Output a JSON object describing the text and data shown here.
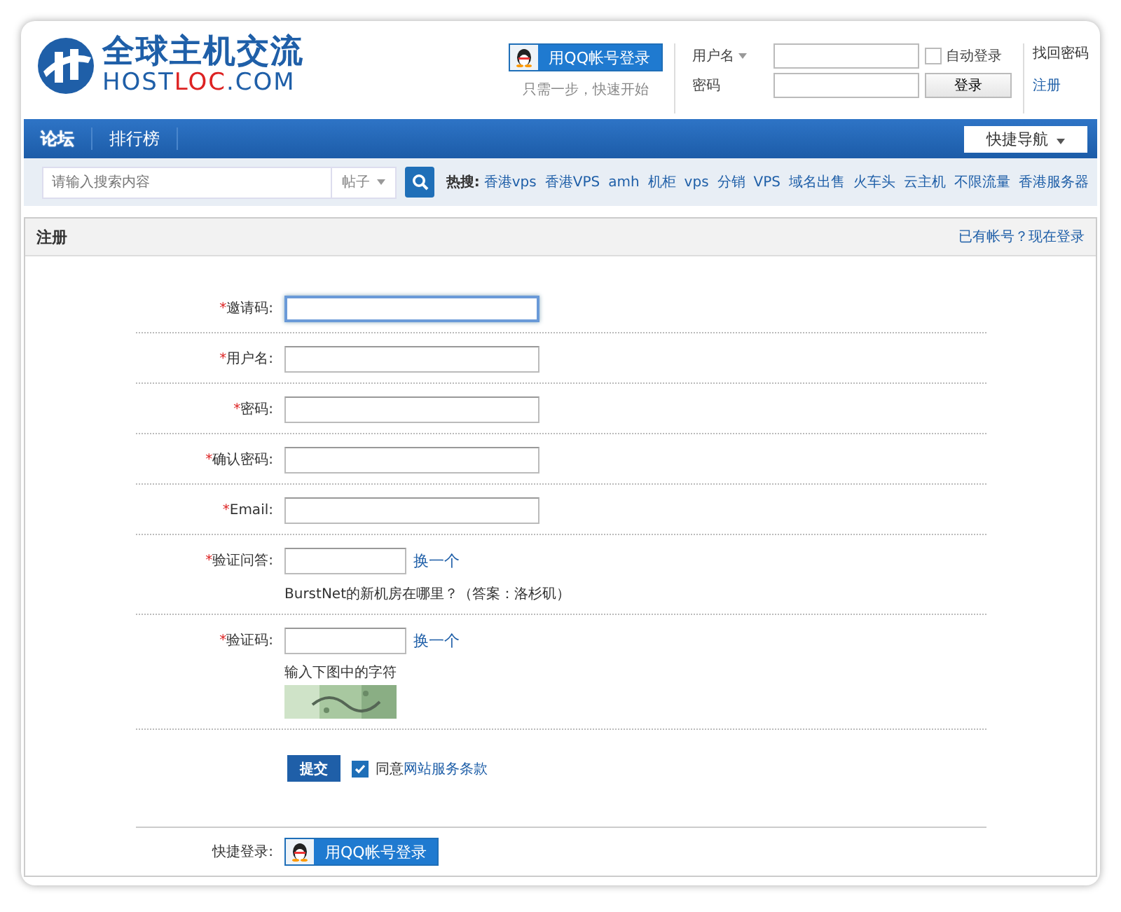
{
  "logo": {
    "title": "全球主机交流",
    "domain_prefix": "HOST",
    "domain_highlight": "LOC",
    "domain_suffix": ".COM"
  },
  "header_login": {
    "qq_button": "用QQ帐号登录",
    "qq_hint": "只需一步，快速开始",
    "username_label": "用户名",
    "password_label": "密码",
    "auto_login": {
      "label": "自动登录",
      "checked": false
    },
    "login_button": "登录",
    "links": [
      "找回密码",
      "注册"
    ]
  },
  "nav": {
    "items": [
      {
        "label": "论坛",
        "selected": true
      },
      {
        "label": "排行榜",
        "selected": false
      }
    ],
    "quick_nav": "快捷导航"
  },
  "search": {
    "placeholder": "请输入搜索内容",
    "type": "帖子",
    "hot_label": "热搜:",
    "hot_terms": [
      "香港vps",
      "香港VPS",
      "amh",
      "机柜",
      "vps",
      "分销",
      "VPS",
      "域名出售",
      "火车头",
      "云主机",
      "不限流量",
      "香港服务器"
    ]
  },
  "panel": {
    "title": "注册",
    "login_link": "已有帐号？现在登录"
  },
  "fields": [
    {
      "mark": "*",
      "label": "邀请码:",
      "kind": "text",
      "focused": true
    },
    {
      "mark": "*",
      "label": "用户名:",
      "kind": "text",
      "focused": false
    },
    {
      "mark": "*",
      "label": "密码:",
      "kind": "text",
      "focused": false
    },
    {
      "mark": "*",
      "label": "确认密码:",
      "kind": "text",
      "focused": false
    },
    {
      "mark": "*",
      "label": "Email:",
      "kind": "text",
      "focused": false
    },
    {
      "mark": "*",
      "label": "验证问答:",
      "kind": "question",
      "focused": false,
      "refresh": "换一个",
      "hint": "BurstNet的新机房在哪里？（答案：洛杉矶）"
    },
    {
      "mark": "*",
      "label": "验证码:",
      "kind": "captcha",
      "focused": false,
      "refresh": "换一个",
      "hint": "输入下图中的字符"
    }
  ],
  "submit": {
    "button": "提交",
    "agree": {
      "checked": true,
      "prefix": "同意",
      "link": "网站服务条款"
    }
  },
  "quick_login": {
    "label": "快捷登录:",
    "button": "用QQ帐号登录"
  }
}
